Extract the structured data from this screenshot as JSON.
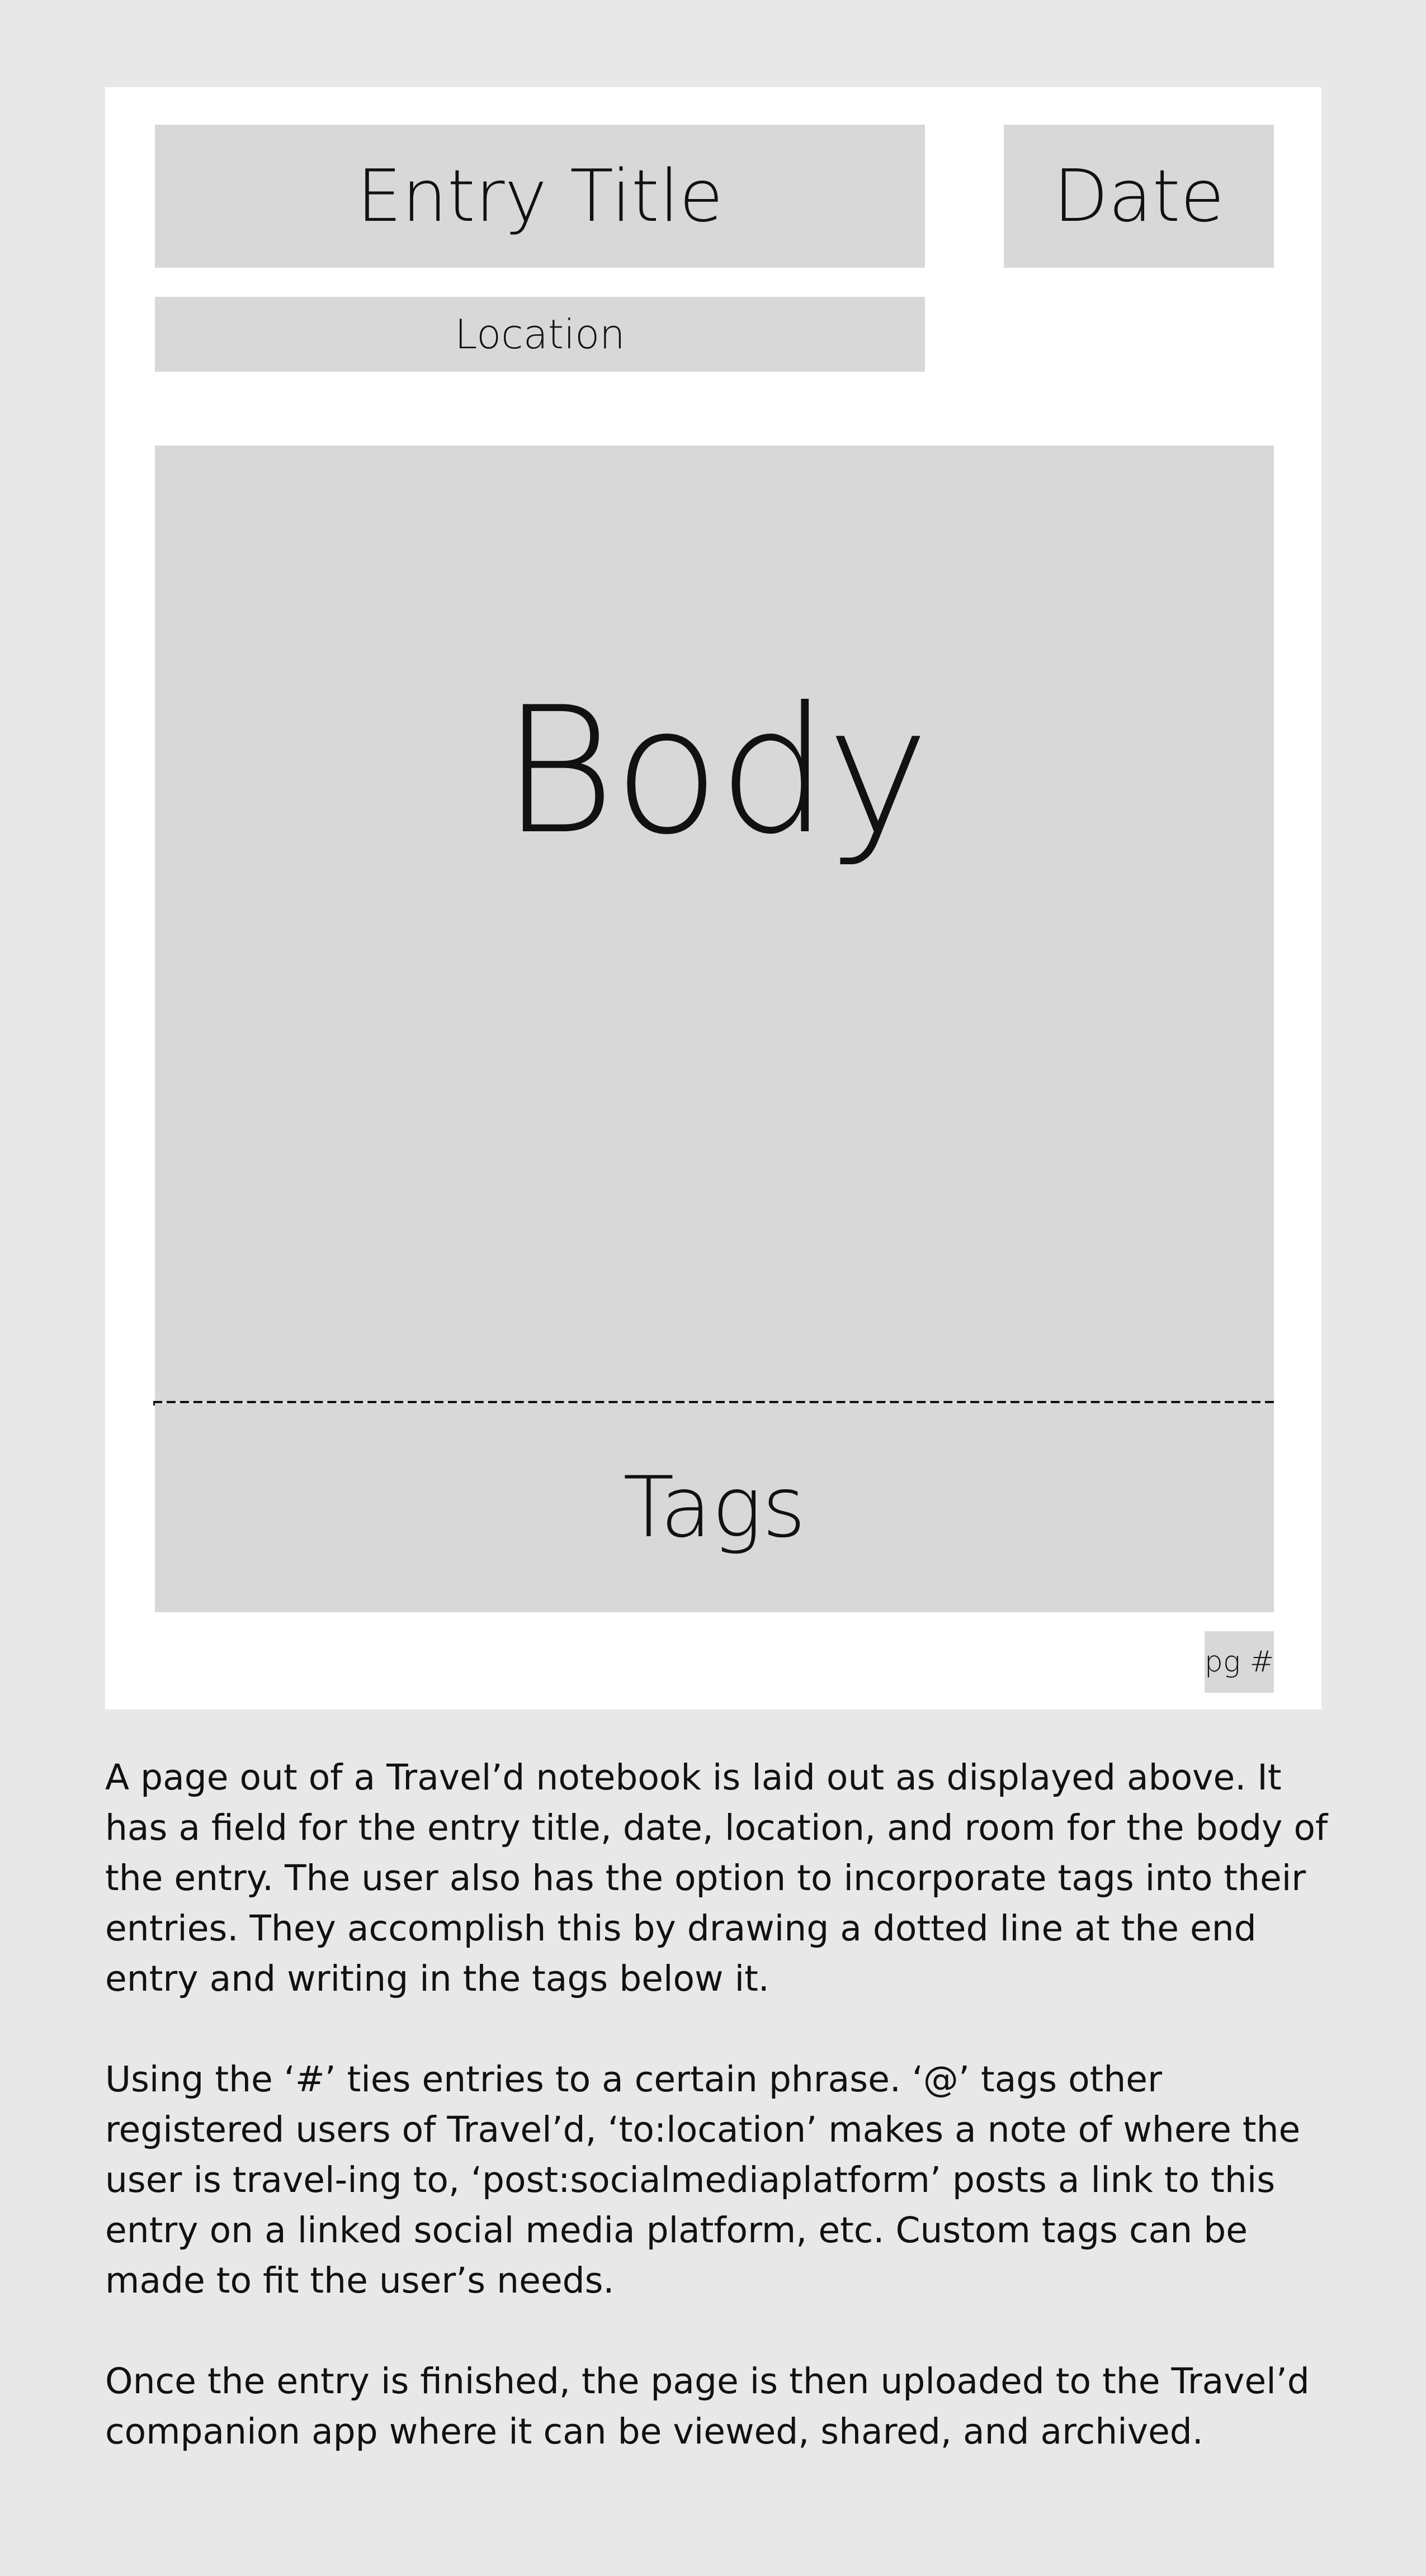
{
  "notebook_page": {
    "entry_title": "Entry Title",
    "date": "Date",
    "location": "Location",
    "body": "Body",
    "tags": "Tags",
    "page_number": "pg #"
  },
  "description": {
    "paragraphs": [
      "A page out of a Travel’d notebook is laid out as displayed above. It has a field for the entry title, date, location, and room for the body of the entry. The user also has the option to incorporate tags into their entries. They accomplish this by drawing a dotted line at the end entry and writing in the tags below it.",
      "Using the ‘#’ ties entries to a certain phrase. ‘@’ tags other registered users of Travel’d, ‘to:location’ makes a note of where the user is travel-ing to, ‘post:socialmediaplatform’ posts a link to this entry on a linked social media platform, etc. Custom tags can be made to fit the user’s needs.",
      "Once the entry is finished, the page is then uploaded to the Travel’d companion app where it can be viewed, shared, and archived."
    ]
  }
}
